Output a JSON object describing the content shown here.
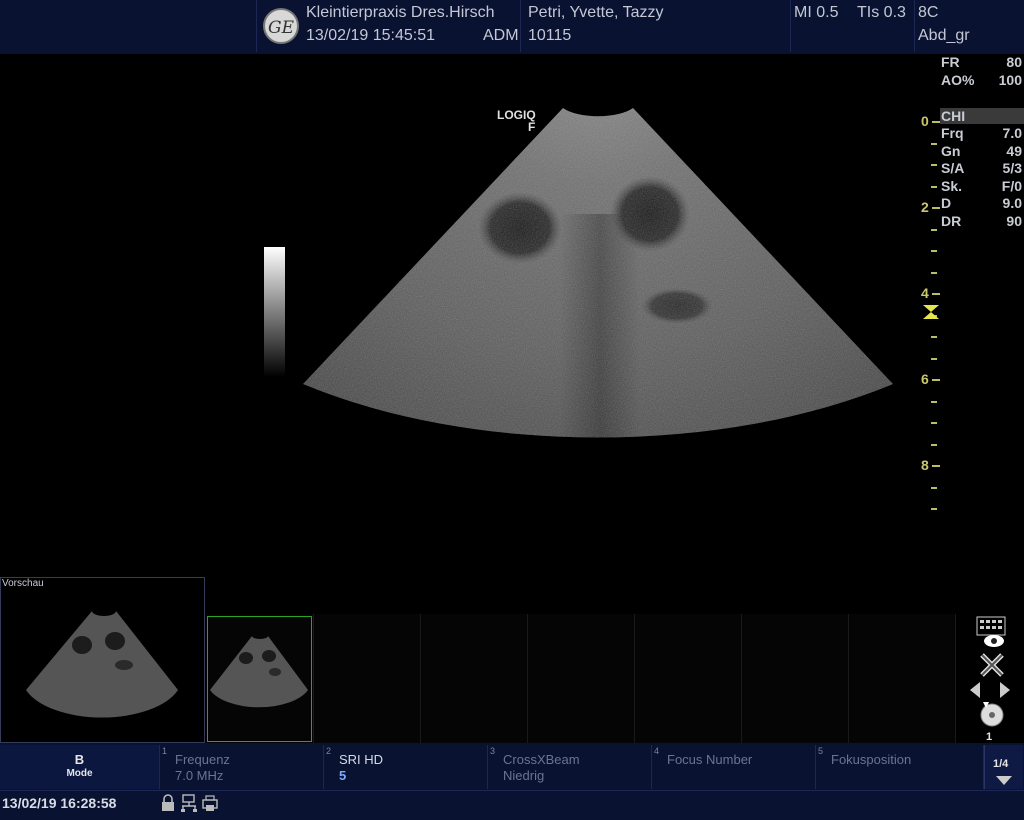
{
  "header": {
    "clinic": "Kleintierpraxis Dres.Hirsch",
    "datetime": "13/02/19 15:45:51",
    "operator": "ADM",
    "patient_name": "Petri, Yvette, Tazzy",
    "patient_id": "10115",
    "mi": "MI 0.5",
    "tis": "TIs 0.3",
    "probe": "8C",
    "preset": "Abd_gr",
    "logo_text": "GE"
  },
  "image_area": {
    "probe_label_line1": "LOGIQ",
    "probe_label_line2": "F"
  },
  "params": [
    {
      "label": "FR",
      "value": "80"
    },
    {
      "label": "AO%",
      "value": "100"
    },
    {
      "label": "CHI",
      "value": ""
    },
    {
      "label": "Frq",
      "value": "7.0"
    },
    {
      "label": "Gn",
      "value": "49"
    },
    {
      "label": "S/A",
      "value": "5/3"
    },
    {
      "label": "Sk.",
      "value": "F/0"
    },
    {
      "label": "D",
      "value": "9.0"
    },
    {
      "label": "DR",
      "value": "90"
    }
  ],
  "depth_labels": [
    "0",
    "2",
    "4",
    "6",
    "8"
  ],
  "preview": {
    "label": "Vorschau",
    "page": "1"
  },
  "menu": [
    {
      "num": "",
      "title": "B",
      "value": "Mode"
    },
    {
      "num": "1",
      "title": "Frequenz",
      "value": "7.0 MHz"
    },
    {
      "num": "2",
      "title": "SRI HD",
      "value": "5"
    },
    {
      "num": "3",
      "title": "CrossXBeam",
      "value": "Niedrig"
    },
    {
      "num": "4",
      "title": "Focus Number",
      "value": ""
    },
    {
      "num": "5",
      "title": "Fokusposition",
      "value": ""
    }
  ],
  "menu_page": "1/4",
  "status": {
    "datetime": "13/02/19 16:28:58"
  },
  "colors": {
    "header_bg": "#0a1232",
    "depth_scale": "#c8c86a",
    "selected_thumb": "#2aa52a"
  }
}
